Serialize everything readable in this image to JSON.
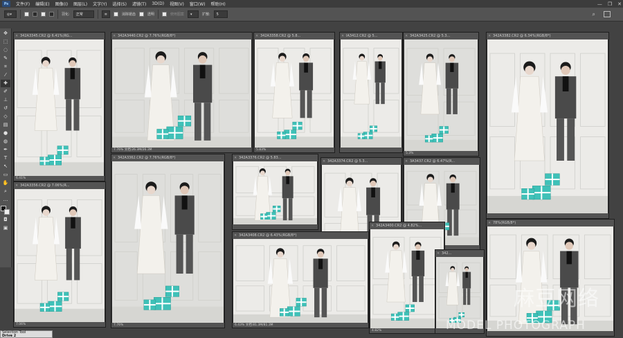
{
  "menubar": {
    "logo": "Ps",
    "items": [
      "文件(F)",
      "编辑(E)",
      "图像(I)",
      "图层(L)",
      "文字(Y)",
      "选择(S)",
      "滤镜(T)",
      "3D(D)",
      "视图(V)",
      "窗口(W)",
      "帮助(H)"
    ],
    "window_controls": [
      "—",
      "❐",
      "✕"
    ]
  },
  "options": {
    "feather_label": "羽化:",
    "feather_value": "正常",
    "antialias_label": "消除锯齿",
    "transparent_label": "透明",
    "use_pattern_label": "使用图案",
    "spread_label": "扩散:",
    "spread_value": "5"
  },
  "toolbar": {
    "tools": [
      "move-tool",
      "artboard-tool",
      "lasso-tool",
      "quick-select-tool",
      "crop-tool",
      "eyedropper-tool",
      "healing-tool",
      "brush-tool",
      "stamp-tool",
      "history-brush-tool",
      "eraser-tool",
      "gradient-tool",
      "blur-tool",
      "dodge-tool",
      "pen-tool",
      "type-tool",
      "path-select-tool",
      "rectangle-tool",
      "hand-tool",
      "zoom-tool"
    ]
  },
  "documents": [
    {
      "title": "342A3345.CR2 @ 6.41%(RG...",
      "status": "6.41%"
    },
    {
      "title": "342A3440.CR2 @ 7.76%(RGB/8*)",
      "status": "7.76%     文档:26.3M/26.3M"
    },
    {
      "title": "342A3358.CR2 @ 5.8...",
      "status": "5.83%"
    },
    {
      "title": "IA3412.CR2 @ 5...",
      "status": ""
    },
    {
      "title": "342A3425.CR2 @ 5.3...",
      "status": "5.3%"
    },
    {
      "title": "342A3382.CR2 @ 6.34%(RGB/8*)",
      "status": ""
    },
    {
      "title": "342A3356.CR2 @ 7.06%(R...",
      "status": "7.06%"
    },
    {
      "title": "342A3362.CR2 @ 7.76%(RGB/8*)",
      "status": "7.76%"
    },
    {
      "title": "342A3376.CR2 @ 5.83...",
      "status": ""
    },
    {
      "title": "342A3374.CR2 @ 5.3...",
      "status": "5.3%"
    },
    {
      "title": "3A3437.CR2 @ 6.47%(R...",
      "status": ""
    },
    {
      "title": "342A3408.CR2 @ 6.43%(RGB/8*)",
      "status": "6.43%     文档:81.3M/81.3M"
    },
    {
      "title": "342A3400.CR2 @ 4.82%...",
      "status": "4.82%"
    },
    {
      "title": "342...",
      "status": ""
    },
    {
      "title": "78%(RGB/8*)",
      "status": ""
    }
  ],
  "taskbar": {
    "line1": "Selection Tool",
    "line2": "Drive 2"
  },
  "watermark": {
    "chinese": "麻豆网络",
    "english": "MODEL PHOTOGRAPH"
  },
  "colors": {
    "accent_teal": "#3fc1b8",
    "workspace": "#424242",
    "panel": "#535353"
  }
}
